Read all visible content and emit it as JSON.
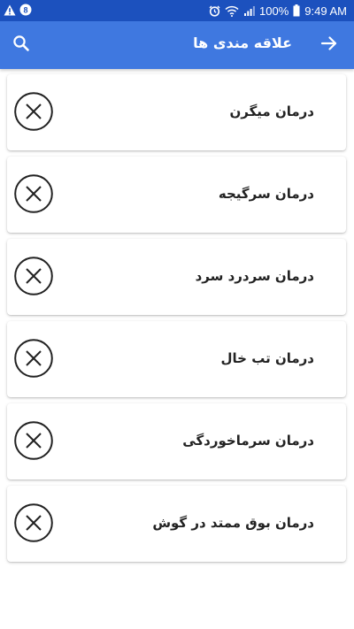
{
  "status_bar": {
    "battery": "100%",
    "time": "9:49 AM",
    "left_icons": [
      "warning-icon",
      "notification-icon"
    ],
    "right_icons": [
      "alarm-icon",
      "wifi-icon",
      "signal-icon",
      "battery-icon"
    ]
  },
  "app_bar": {
    "title": "علاقه مندی ها",
    "back_icon": "arrow-forward-icon",
    "search_icon": "search-icon",
    "color": "#3f78e0"
  },
  "favorites": [
    {
      "title": "درمان میگرن"
    },
    {
      "title": "درمان سرگیجه"
    },
    {
      "title": "درمان سردرد سرد"
    },
    {
      "title": "درمان تب خال"
    },
    {
      "title": "درمان سرماخوردگی"
    },
    {
      "title": "درمان بوق ممتد در گوش"
    }
  ],
  "remove_icon": "close-circle-icon"
}
